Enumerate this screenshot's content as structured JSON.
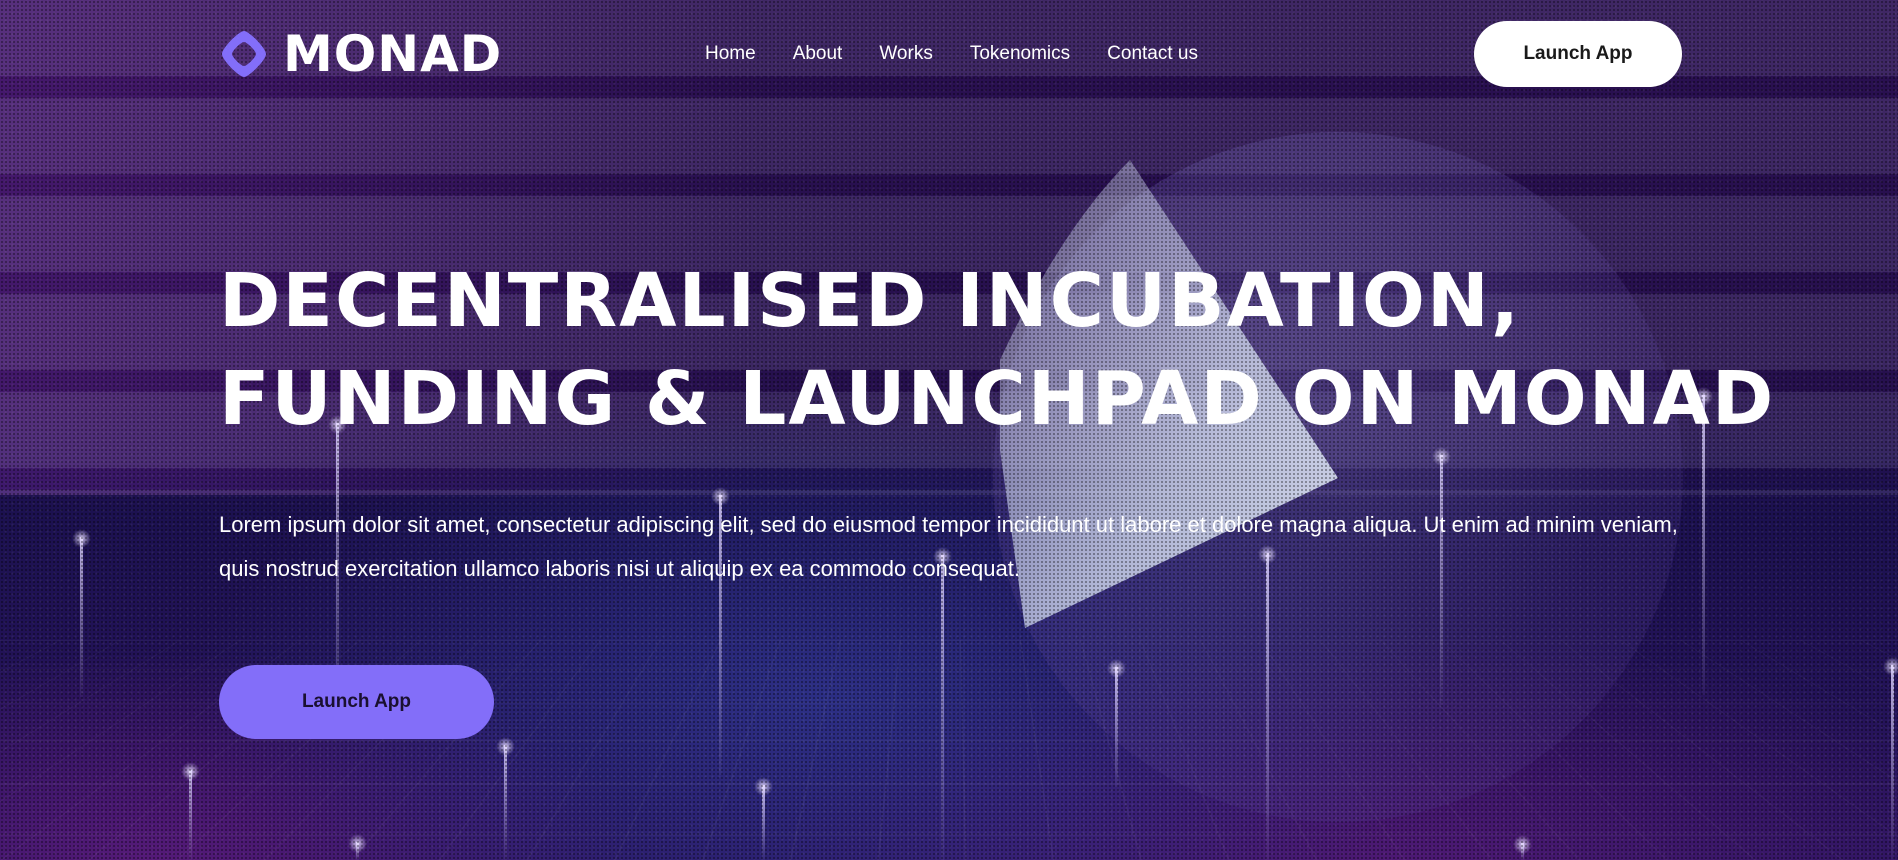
{
  "brand": {
    "name": "MONAD",
    "accent_color": "#836EF9",
    "logo_icon": "monad-diamond-icon"
  },
  "nav": {
    "items": [
      {
        "label": "Home"
      },
      {
        "label": "About"
      },
      {
        "label": "Works"
      },
      {
        "label": "Tokenomics"
      },
      {
        "label": "Contact us"
      }
    ],
    "cta_label": "Launch App"
  },
  "hero": {
    "title_line1": "DECENTRALISED INCUBATION,",
    "title_line2": "FUNDING & LAUNCHPAD ON MONAD",
    "description": "Lorem ipsum dolor sit amet, consectetur adipiscing elit, sed do eiusmod tempor incididunt ut labore et dolore magna aliqua. Ut enim ad minim veniam, quis nostrud exercitation ullamco laboris nisi ut aliquip ex ea commodo consequat.",
    "cta_label": "Launch App"
  }
}
